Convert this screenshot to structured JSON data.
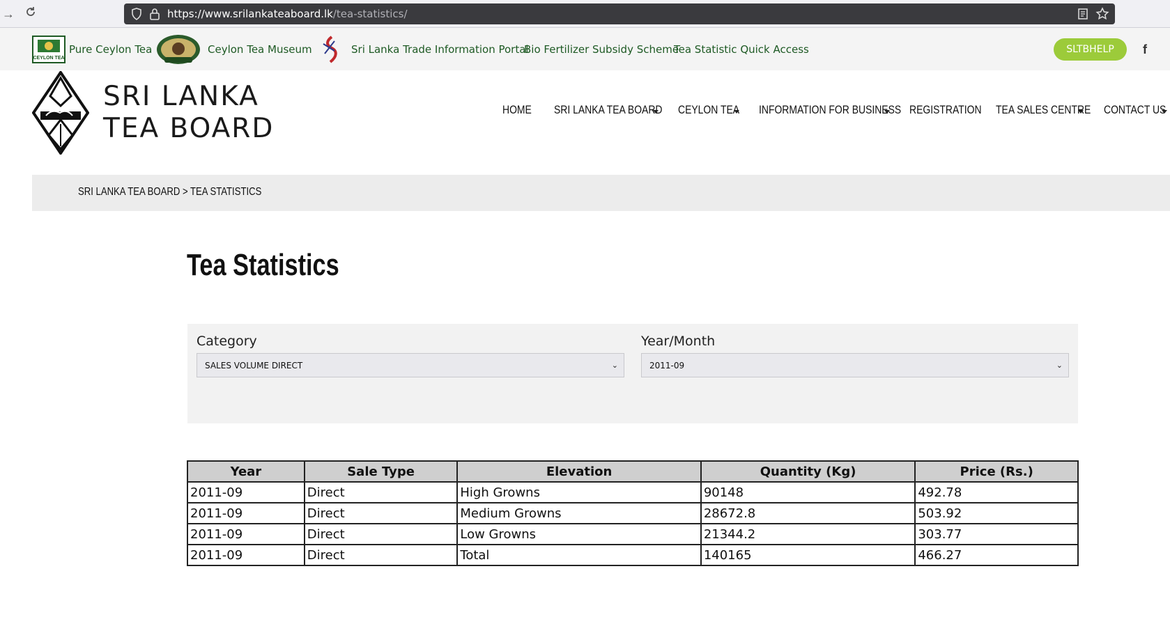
{
  "browser": {
    "url_host": "https://www.srilankateaboard.lk",
    "url_path": "/tea-statistics/"
  },
  "topbar": {
    "links": [
      {
        "label": "Pure Ceylon Tea"
      },
      {
        "label": "Ceylon Tea Museum"
      },
      {
        "label": "Sri Lanka Trade Information Portal"
      },
      {
        "label": "Bio Fertilizer Subsidy Scheme"
      },
      {
        "label": "Tea Statistic Quick Access"
      }
    ],
    "help_button": "SLTBHELP",
    "logo_text": "CEYLON TEA"
  },
  "header": {
    "brand_line1": "SRI LANKA",
    "brand_line2": "TEA BOARD",
    "nav": [
      {
        "label": "HOME"
      },
      {
        "label": "SRI LANKA TEA BOARD"
      },
      {
        "label": "CEYLON TEA"
      },
      {
        "label": "INFORMATION FOR BUSINESS"
      },
      {
        "label": "REGISTRATION"
      },
      {
        "label": "TEA SALES CENTRE"
      },
      {
        "label": "CONTACT US"
      }
    ]
  },
  "breadcrumb": {
    "root": "SRI LANKA TEA BOARD",
    "separator": ">",
    "current": "TEA STATISTICS"
  },
  "page": {
    "title": "Tea Statistics"
  },
  "filters": {
    "category_label": "Category",
    "category_value": "SALES VOLUME DIRECT",
    "yearmonth_label": "Year/Month",
    "yearmonth_value": "2011-09"
  },
  "table": {
    "headers": [
      "Year",
      "Sale Type",
      "Elevation",
      "Quantity (Kg)",
      "Price (Rs.)"
    ],
    "rows": [
      [
        "2011-09",
        "Direct",
        "High Growns",
        "90148",
        "492.78"
      ],
      [
        "2011-09",
        "Direct",
        "Medium Growns",
        "28672.8",
        "503.92"
      ],
      [
        "2011-09",
        "Direct",
        "Low Growns",
        "21344.2",
        "303.77"
      ],
      [
        "2011-09",
        "Direct",
        "Total",
        "140165",
        "466.27"
      ]
    ]
  },
  "colors": {
    "link_green": "#1e5a24",
    "help_button_bg": "#9ccb3a",
    "table_header_bg": "#cfcfcf"
  }
}
